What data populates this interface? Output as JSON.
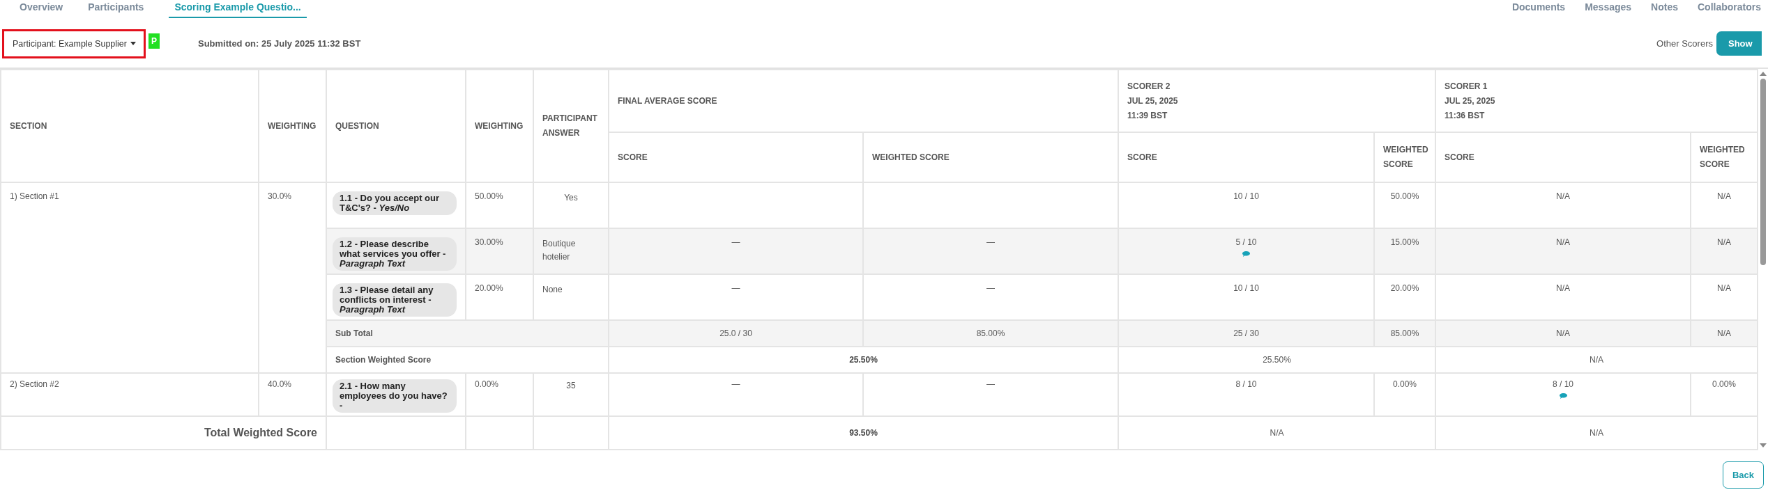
{
  "tabs": [
    {
      "label": "Overview",
      "selected": false
    },
    {
      "label": "Participants",
      "selected": false
    },
    {
      "label": "Scoring Example Questio...",
      "selected": true
    }
  ],
  "right_links": [
    "Documents",
    "Messages",
    "Notes",
    "Collaborators"
  ],
  "participant_dropdown": {
    "label": "Participant: Example Supplier",
    "highlighted": true
  },
  "status_badge": "P",
  "submitted": "Submitted on: 25 July 2025 11:32 BST",
  "other_scorers": {
    "label": "Other Scorers",
    "toggle": "Show",
    "on": true
  },
  "table": {
    "columns": {
      "section": "SECTION",
      "section_weighting": "WEIGHTING",
      "question": "QUESTION",
      "question_weighting": "WEIGHTING",
      "answer": "PARTICIPANT ANSWER",
      "groups": [
        {
          "title": [
            "FINAL AVERAGE SCORE"
          ],
          "score": "SCORE",
          "weighted": "WEIGHTED SCORE"
        },
        {
          "title": [
            "SCORER 2",
            "JUL 25, 2025",
            "11:39 BST"
          ],
          "score": "SCORE",
          "weighted": "WEIGHTED SCORE"
        },
        {
          "title": [
            "SCORER 1",
            "JUL 25, 2025",
            "11:36 BST"
          ],
          "score": "SCORE",
          "weighted": "WEIGHTED SCORE"
        }
      ]
    },
    "sections": [
      {
        "name": "1) Section #1",
        "weighting": "30.0%",
        "questions": [
          {
            "text": "1.1 - Do you accept our T&C's? - *Yes/No*",
            "weighting": "50.00%",
            "answer": "Yes",
            "kind": "short",
            "scorer_2": {
              "score": "10 / 10",
              "weighted": "50.00%",
              "comment": false
            },
            "scorer_1": {
              "score": "N/A",
              "weighted": "N/A",
              "comment": false
            }
          },
          {
            "text": "1.2 - Please describe what services you offer - *Paragraph Text*",
            "weighting": "30.00%",
            "answer": "Boutique hotelier",
            "kind": "paragraph",
            "final": {
              "score": "—",
              "weighted": "—"
            },
            "scorer_2": {
              "score": "5 / 10",
              "weighted": "15.00%",
              "comment": true
            },
            "scorer_1": {
              "score": "N/A",
              "weighted": "N/A",
              "comment": false
            }
          },
          {
            "text": "1.3 - Please detail any conflicts on interest - *Paragraph Text*",
            "weighting": "20.00%",
            "answer": "None",
            "kind": "paragraph",
            "final": {
              "score": "—",
              "weighted": "—"
            },
            "scorer_2": {
              "score": "10 / 10",
              "weighted": "20.00%",
              "comment": false
            },
            "scorer_1": {
              "score": "N/A",
              "weighted": "N/A",
              "comment": false
            }
          }
        ],
        "subtotal": {
          "label": "Sub Total",
          "final": {
            "score": "25.0 / 30",
            "weighted": "85.00%"
          },
          "scorer_2": {
            "score": "25 / 30",
            "weighted": "85.00%"
          },
          "scorer_1": {
            "score": "N/A",
            "weighted": "N/A"
          }
        },
        "section_weighted": {
          "label": "Section Weighted Score",
          "values": [
            "25.50%",
            "25.50%",
            "N/A"
          ]
        }
      },
      {
        "name": "2) Section #2",
        "weighting": "40.0%",
        "questions": [
          {
            "text": "2.1 - How many employees do you have? -",
            "weighting": "0.00%",
            "answer": "35",
            "kind": "short",
            "final": {
              "score": "—",
              "weighted": "—"
            },
            "scorer_2": {
              "score": "8 / 10",
              "weighted": "0.00%",
              "comment": false
            },
            "scorer_1": {
              "score": "8 / 10",
              "weighted": "0.00%",
              "comment": true
            }
          }
        ]
      }
    ],
    "total": {
      "label": "Total Weighted Score",
      "values": [
        "93.50%",
        "N/A",
        "N/A"
      ]
    }
  },
  "back_button": "Back"
}
